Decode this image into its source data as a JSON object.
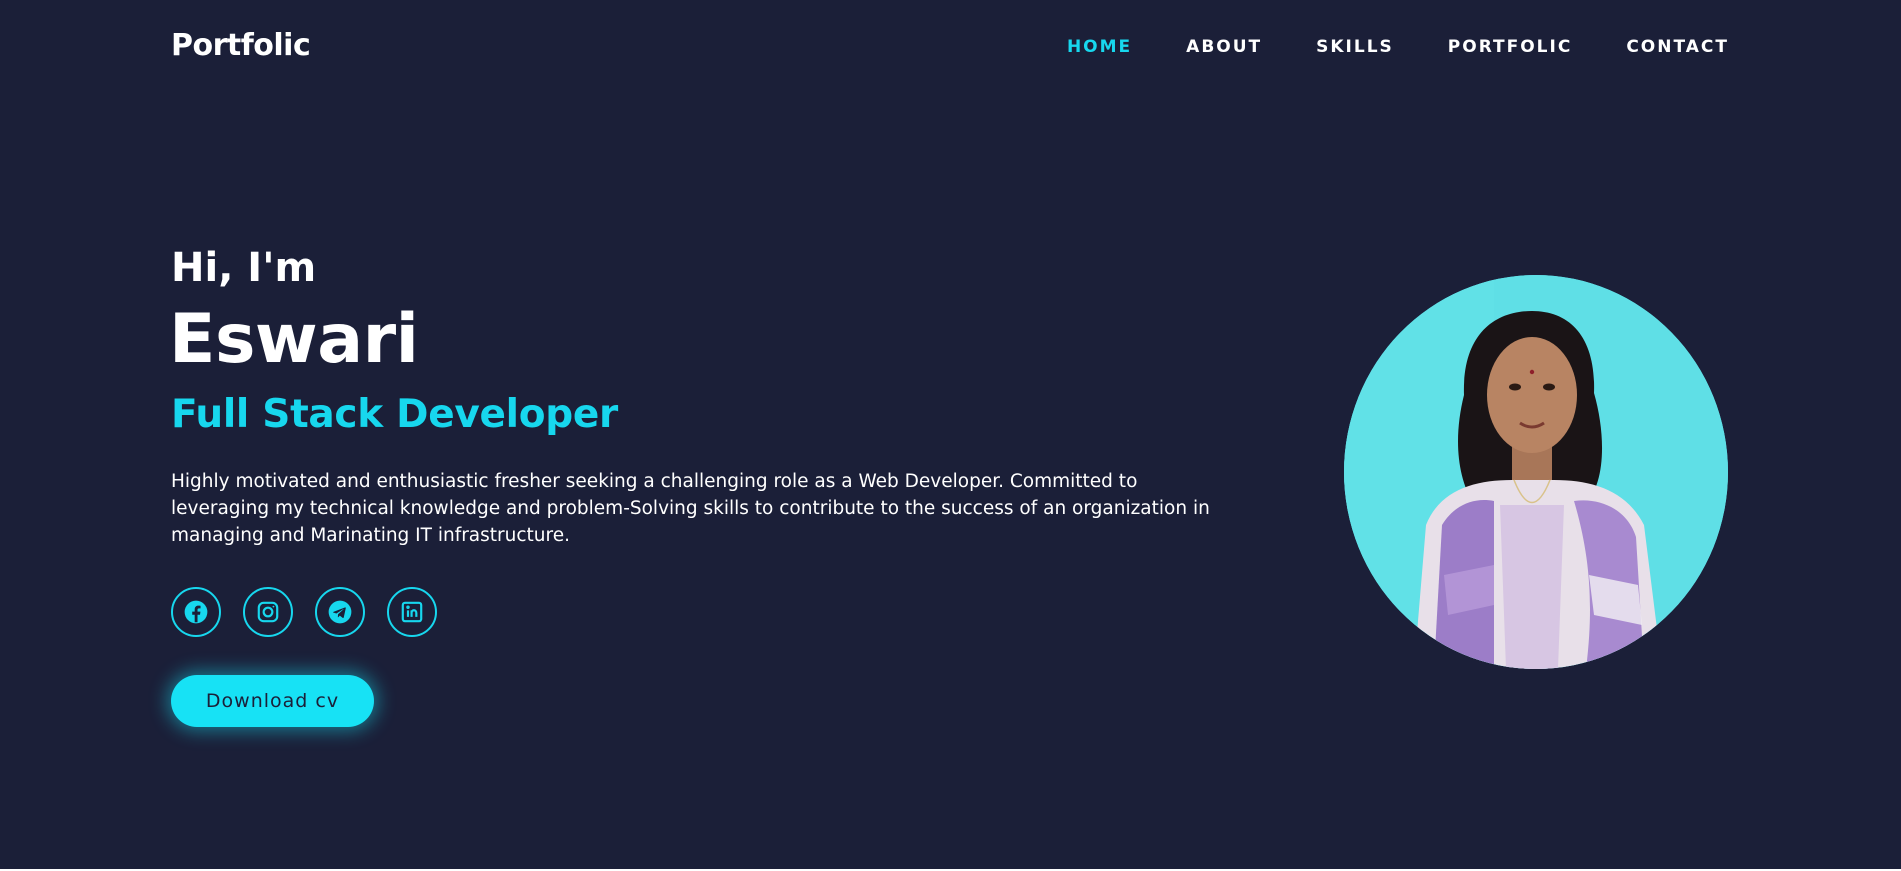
{
  "header": {
    "logo": "Portfolic",
    "nav": [
      {
        "label": "HOME",
        "active": true
      },
      {
        "label": "ABOUT",
        "active": false
      },
      {
        "label": "SKILLS",
        "active": false
      },
      {
        "label": "PORTFOLIC",
        "active": false
      },
      {
        "label": "CONTACT",
        "active": false
      }
    ]
  },
  "hero": {
    "greeting": "Hi, I'm",
    "name": "Eswari",
    "role": "Full Stack Developer",
    "bio": "Highly motivated and enthusiastic fresher seeking a challenging role as a Web Developer. Committed to leveraging my technical knowledge and problem-Solving skills to contribute to the success of an organization in managing and Marinating IT infrastructure.",
    "socials": [
      {
        "icon": "facebook-icon"
      },
      {
        "icon": "instagram-icon"
      },
      {
        "icon": "telegram-icon"
      },
      {
        "icon": "linkedin-icon"
      }
    ],
    "cv_button": "Download cv"
  },
  "colors": {
    "background": "#1b1f38",
    "accent": "#17d7ee",
    "text": "#ffffff",
    "photo_background": "#5fdfe6"
  }
}
